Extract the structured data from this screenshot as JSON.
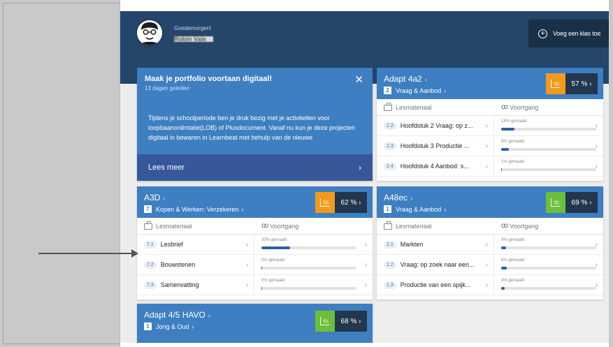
{
  "header": {
    "greeting": "Goedemorgen!",
    "username": "Robin Vale",
    "add_class_label": "Voeg een klas toe"
  },
  "promo": {
    "title": "Maak je portfolio voortaan digitaal!",
    "date": "13 dagen geleden",
    "body": "Tijdens je schoolperiode ben je druk bezig met je activiteiten voor loopbaanoriëntatie(LOB) of Plusdocument. Vanaf nu kun je deze projecten digitaal in bewaren in Learnbeat met behulp van de nieuwe",
    "more_label": "Lees meer"
  },
  "columns": {
    "material": "Lesmateriaal",
    "progress": "Voortgang"
  },
  "classes": [
    {
      "title": "Adapt 4a2",
      "chapter_num": "2",
      "chapter": "Vraag & Aanbod",
      "score": "57 %",
      "score_color": "#f29a1d",
      "rows": [
        {
          "num": "2.2",
          "label": "Hoofdstuk 2 Vraag: op z...",
          "done": "14% gemaakt",
          "pct": 14
        },
        {
          "num": "2.3",
          "label": "Hoofdstuk 3 Productie ...",
          "done": "8% gemaakt",
          "pct": 8
        },
        {
          "num": "2.4",
          "label": "Hoofdstuk 4 Aanbod: s...",
          "done": "1% gemaakt",
          "pct": 1
        }
      ]
    },
    {
      "title": "A3D",
      "chapter_num": "7",
      "chapter": "Kopen & Werken: Verzekeren",
      "score": "62 %",
      "score_color": "#f29a1d",
      "rows": [
        {
          "num": "7.1",
          "label": "Lesbrief",
          "done": "30% gemaakt",
          "pct": 30
        },
        {
          "num": "7.2",
          "label": "Bouwstenen",
          "done": "0% gemaakt",
          "pct": 0
        },
        {
          "num": "7.3",
          "label": "Samenvatting",
          "done": "0% gemaakt",
          "pct": 0
        }
      ]
    },
    {
      "title": "A48ec",
      "chapter_num": "1",
      "chapter": "Vraag & Aanbod",
      "score": "69 %",
      "score_color": "#6bbf3c",
      "rows": [
        {
          "num": "1.1",
          "label": "Markten",
          "done": "5% gemaakt",
          "pct": 5
        },
        {
          "num": "1.2",
          "label": "Vraag: op zoek naar een...",
          "done": "6% gemaakt",
          "pct": 6
        },
        {
          "num": "1.3",
          "label": "Productie van een spijk...",
          "done": "4% gemaakt",
          "pct": 4
        }
      ]
    },
    {
      "title": "Adapt 4/5 HAVO",
      "chapter_num": "1",
      "chapter": "Jong & Oud",
      "score": "68 %",
      "score_color": "#6bbf3c"
    }
  ]
}
